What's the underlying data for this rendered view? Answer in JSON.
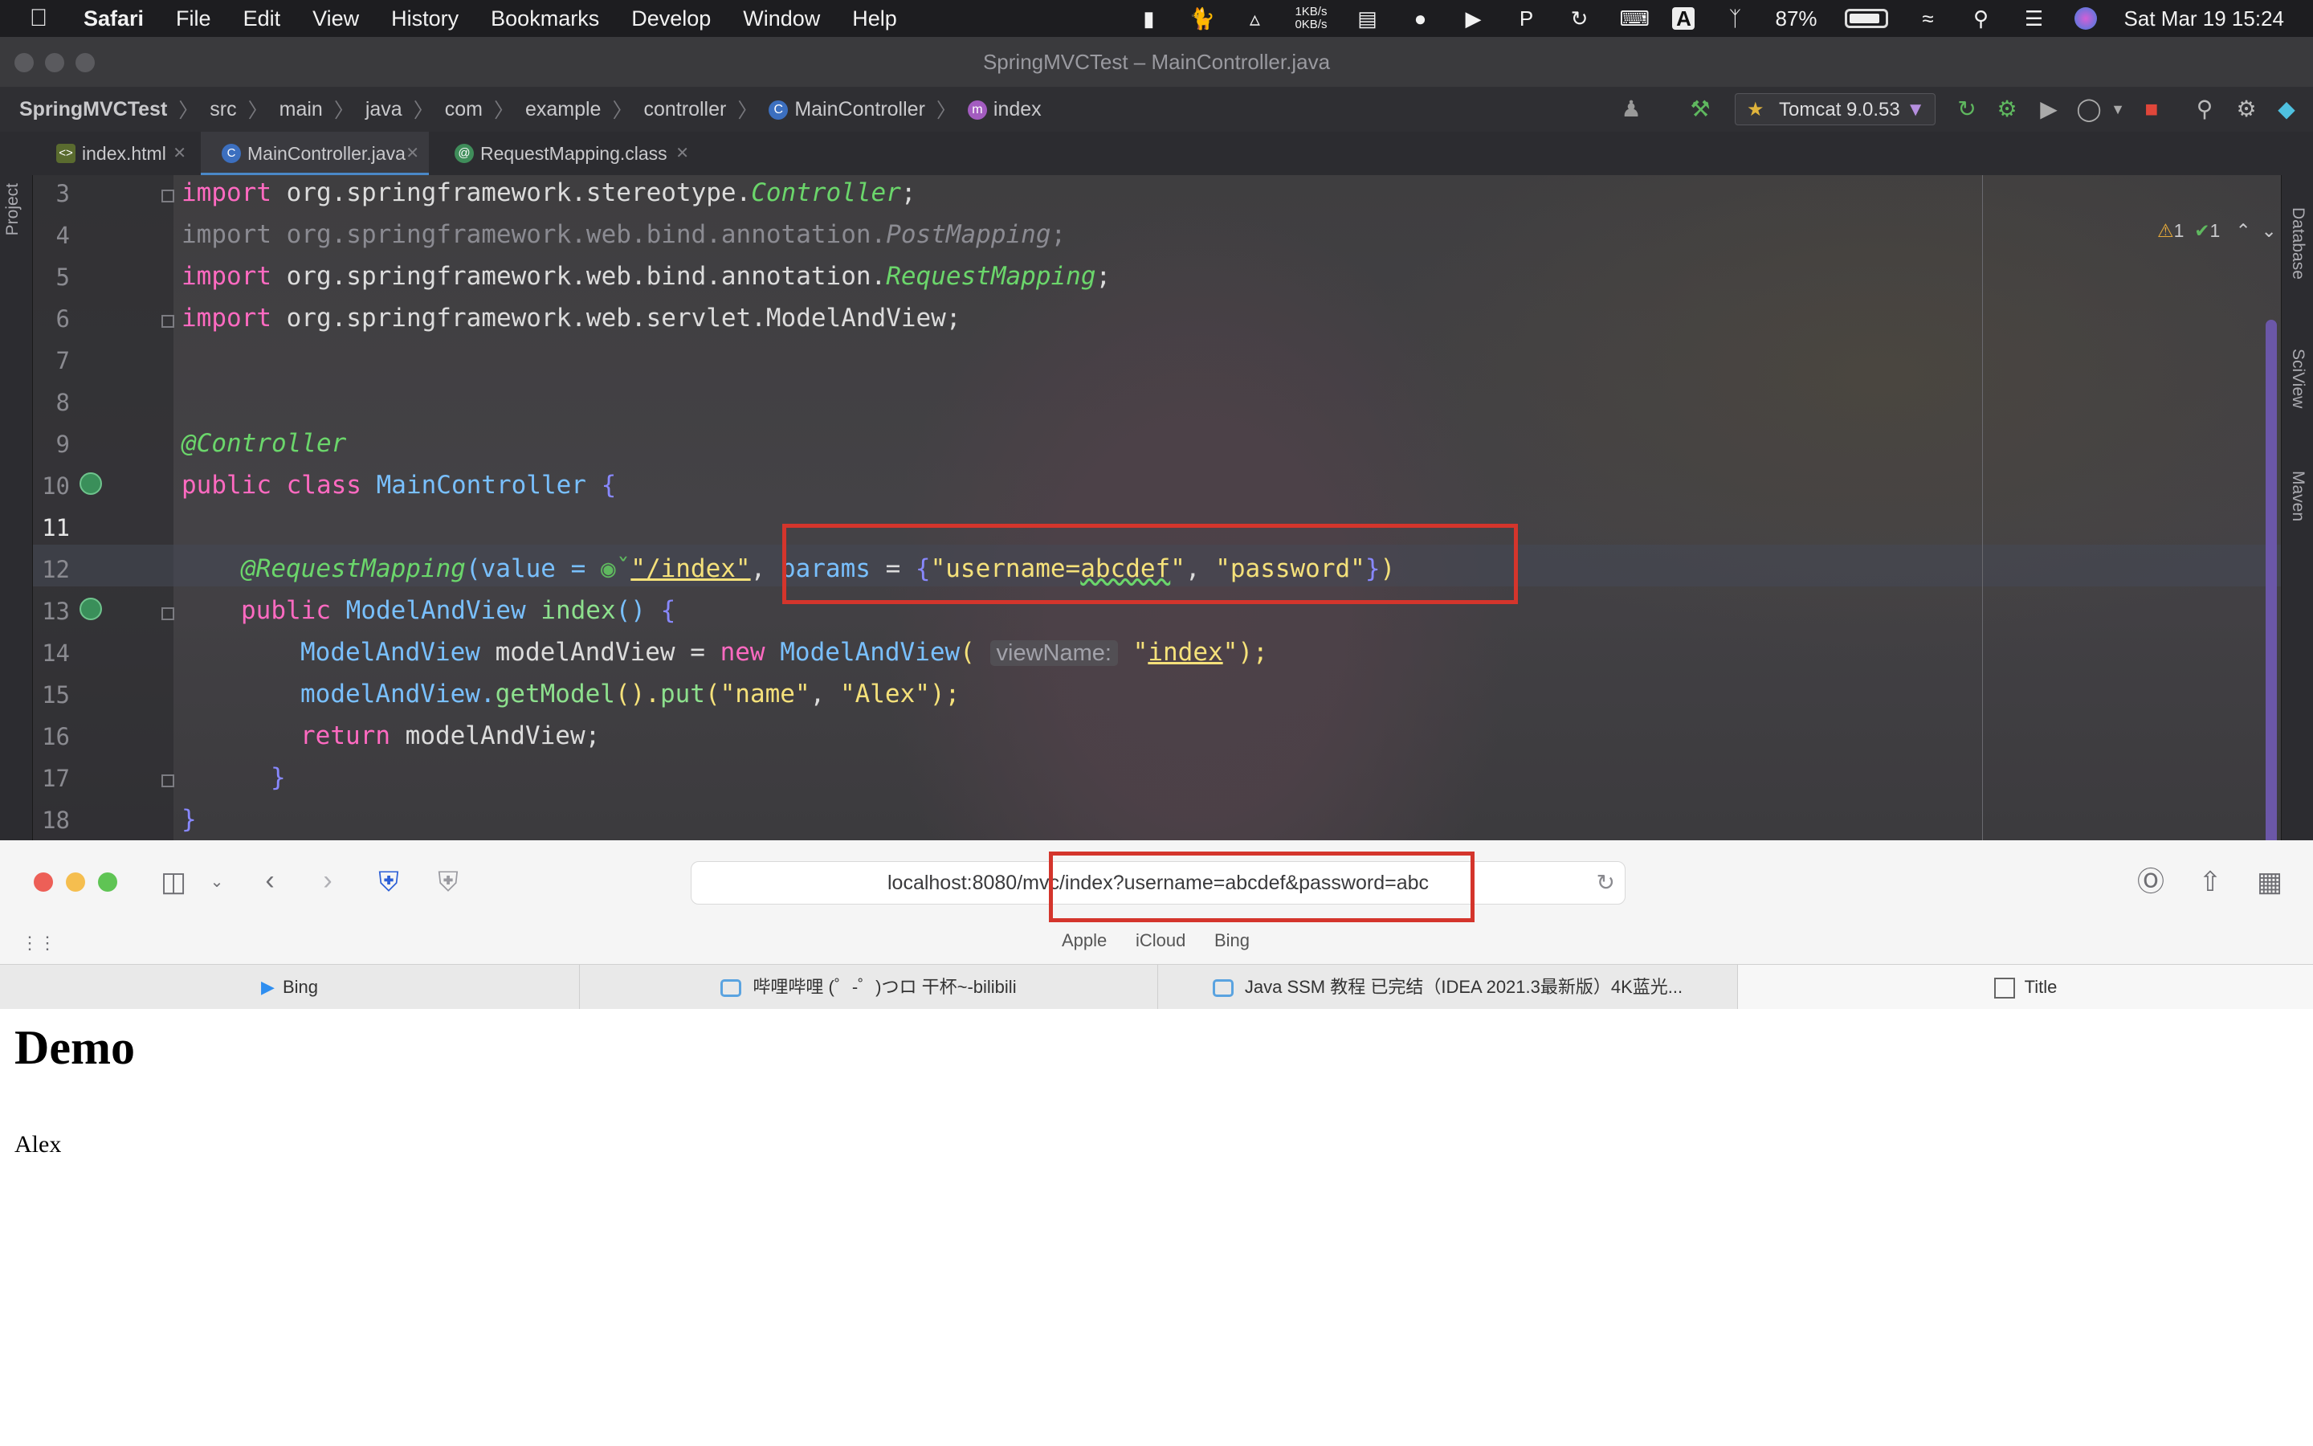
{
  "menubar": {
    "app": "Safari",
    "items": [
      "File",
      "Edit",
      "View",
      "History",
      "Bookmarks",
      "Develop",
      "Window",
      "Help"
    ],
    "net_up": "1KB/s",
    "net_down": "0KB/s",
    "input_letter": "A",
    "battery": "87%",
    "battery_level": 0.87,
    "datetime": "Sat Mar 19  15:24"
  },
  "ide": {
    "title": "SpringMVCTest – MainController.java",
    "breadcrumb": [
      "SpringMVCTest",
      "src",
      "main",
      "java",
      "com",
      "example",
      "controller",
      "MainController",
      "index"
    ],
    "run_config": "Tomcat 9.0.53",
    "tabs": [
      {
        "label": "index.html",
        "icon": "html-file-icon"
      },
      {
        "label": "MainController.java",
        "icon": "java-class-icon"
      },
      {
        "label": "RequestMapping.class",
        "icon": "annotation-class-icon"
      }
    ],
    "left_panel": "Project",
    "right_panels": [
      "Database",
      "SciView",
      "Maven"
    ],
    "inspection": {
      "warnings": "1",
      "checks": "1"
    },
    "lines": [
      "3",
      "4",
      "5",
      "6",
      "7",
      "8",
      "9",
      "10",
      "11",
      "12",
      "13",
      "14",
      "15",
      "16",
      "17",
      "18"
    ],
    "current_line": "11",
    "code": {
      "l3_kw": "import",
      "l3_pkg": " org.springframework.stereotype.",
      "l3_cls": "Controller",
      "l3_end": ";",
      "l4": "import org.springframework.web.bind.annotation.",
      "l4_cls": "PostMapping",
      "l4_end": ";",
      "l5_kw": "import",
      "l5_pkg": " org.springframework.web.bind.annotation.",
      "l5_cls": "RequestMapping",
      "l5_end": ";",
      "l6_kw": "import",
      "l6_pkg": " org.springframework.web.servlet.ModelAndView;",
      "l8_ann": "@Controller",
      "l9_kw": "public class ",
      "l9_cls": "MainController",
      "l9_brace": " {",
      "l11_ann": "@RequestMapping",
      "l11_a": "(value = ",
      "l11_url": "\"/index\"",
      "l11_b": ", ",
      "l11_params": "params",
      "l11_c": " = ",
      "l11_brace1": "{",
      "l11_s1a": "\"username=",
      "l11_s1b": "abcdef",
      "l11_s1c": "\"",
      "l11_d": ", ",
      "l11_s2": "\"password\"",
      "l11_brace2": "}",
      "l11_e": ")",
      "l12_kw": "public ",
      "l12_cls": "ModelAndView ",
      "l12_fn": "index",
      "l12_rest": "() ",
      "l12_brace": "{",
      "l13_cls": "ModelAndView",
      "l13_a": " modelAndView = ",
      "l13_kw": "new ",
      "l13_cls2": "ModelAndView",
      "l13_b": "( ",
      "l13_hint": "viewName:",
      "l13_str1": "\"",
      "l13_str2": "index",
      "l13_str3": "\"",
      "l13_end": ");",
      "l14_a": "modelAndView.",
      "l14_fn1": "getModel",
      "l14_b": "().",
      "l14_fn2": "put",
      "l14_c": "(",
      "l14_s1": "\"name\"",
      "l14_d": ", ",
      "l14_s2": "\"Alex\"",
      "l14_e": ");",
      "l15_kw": "return ",
      "l15_rest": "modelAndView;",
      "l16": "}",
      "l17": "}"
    }
  },
  "safari": {
    "url": "localhost:8080/mvc/index?username=abcdef&password=abc",
    "favorites": [
      "Apple",
      "iCloud",
      "Bing"
    ],
    "tabs": [
      {
        "label": "Bing"
      },
      {
        "label": "哔哩哔哩 (゜-゜)つロ 干杯~-bilibili"
      },
      {
        "label": "Java SSM 教程 已完结（IDEA 2021.3最新版）4K蓝光..."
      },
      {
        "label": "Title"
      }
    ],
    "page": {
      "heading": "Demo",
      "text": "Alex"
    }
  }
}
